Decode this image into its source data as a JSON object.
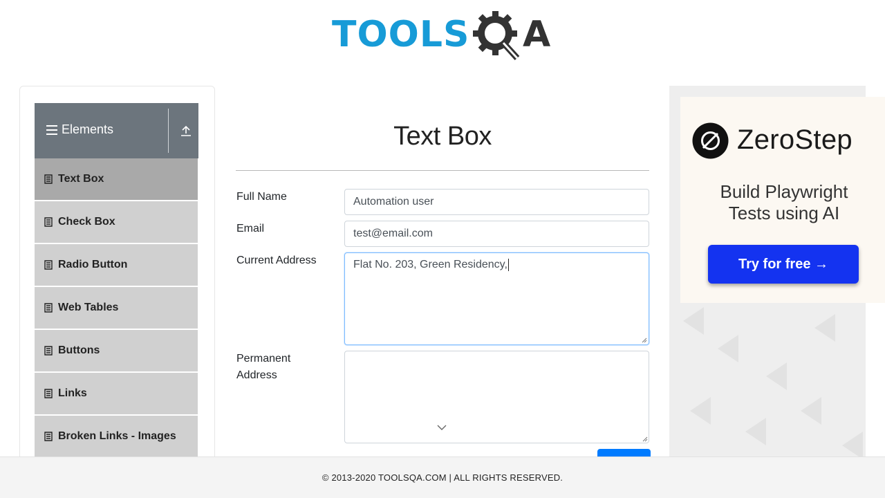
{
  "logo": {
    "text_primary": "TOOLS",
    "text_secondary": "QA",
    "primary_color": "#179bd7",
    "secondary_color": "#333333",
    "icon": "gear-magnifier-icon"
  },
  "sidebar": {
    "group_title": "Elements",
    "group_icon": "hamburger-icon",
    "collapse_icon": "upload-arrow-icon",
    "items": [
      {
        "label": "Text Box",
        "active": true,
        "icon": "document-icon"
      },
      {
        "label": "Check Box",
        "active": false,
        "icon": "document-icon"
      },
      {
        "label": "Radio Button",
        "active": false,
        "icon": "document-icon"
      },
      {
        "label": "Web Tables",
        "active": false,
        "icon": "document-icon"
      },
      {
        "label": "Buttons",
        "active": false,
        "icon": "document-icon"
      },
      {
        "label": "Links",
        "active": false,
        "icon": "document-icon"
      },
      {
        "label": "Broken Links - Images",
        "active": false,
        "icon": "document-icon"
      }
    ]
  },
  "main": {
    "title": "Text Box",
    "form": {
      "full_name": {
        "label": "Full Name",
        "value": "Automation user"
      },
      "email": {
        "label": "Email",
        "value": "test@email.com"
      },
      "current_address": {
        "label": "Current Address",
        "value": "Flat No. 203, Green Residency,"
      },
      "permanent_address": {
        "label_line1": "Permanent",
        "label_line2": "Address",
        "value": ""
      },
      "submit_color": "#007bff"
    }
  },
  "ad": {
    "brand": "ZeroStep",
    "tagline_line1": "Build Playwright",
    "tagline_line2": "Tests using AI",
    "cta": "Try for free →",
    "cta_color": "#1433f0"
  },
  "footer": {
    "text": "© 2013-2020 TOOLSQA.COM | ALL RIGHTS RESERVED."
  }
}
